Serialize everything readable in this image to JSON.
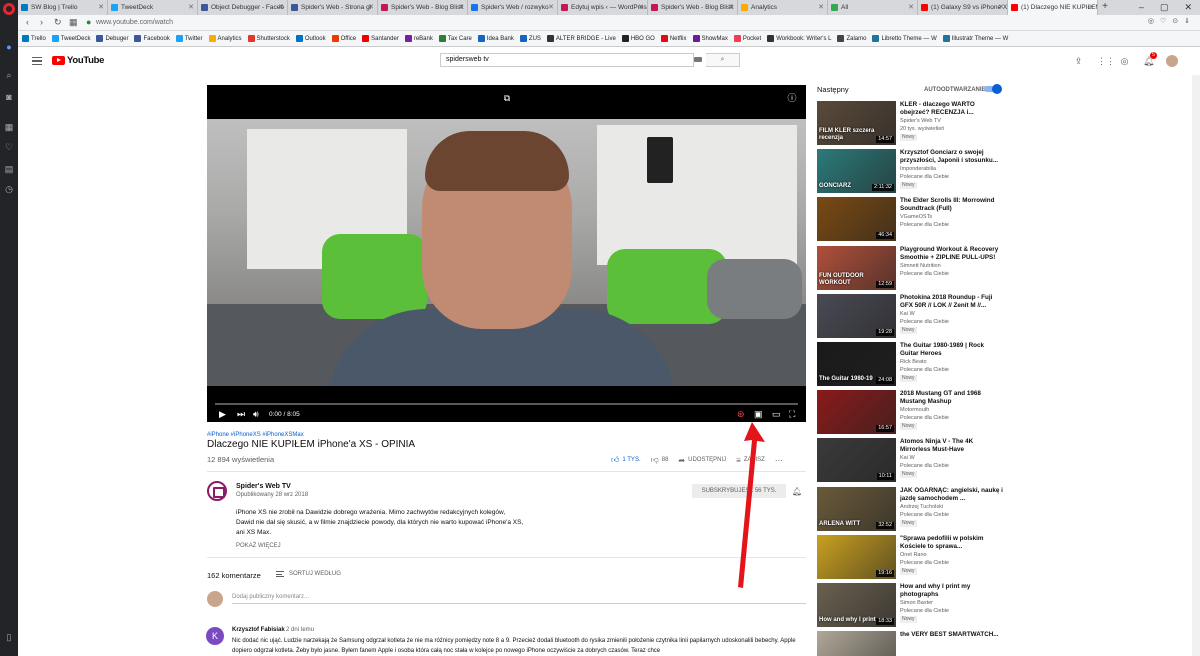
{
  "browser": {
    "tabs": [
      {
        "label": "SW Blog | Trello",
        "color": "#0079bf"
      },
      {
        "label": "TweetDeck",
        "color": "#1da1f2"
      },
      {
        "label": "Object Debugger - Faceb",
        "color": "#3b5998"
      },
      {
        "label": "Spider's Web - Strona gł",
        "color": "#3b5998"
      },
      {
        "label": "Spider's Web - Blog Blisk",
        "color": "#c2185b"
      },
      {
        "label": "Spider's Web / rozwyko",
        "color": "#1a73e8"
      },
      {
        "label": "Edytuj wpis ‹ — WordPres",
        "color": "#c2185b"
      },
      {
        "label": "Spider's Web - Blog Blisk",
        "color": "#c2185b"
      },
      {
        "label": "Analytics",
        "color": "#f9ab00"
      },
      {
        "label": "All",
        "color": "#34a853"
      },
      {
        "label": "(1) Galaxy S9 vs iPhone X",
        "color": "#ff0000"
      },
      {
        "label": "(1) Dlaczego NIE KUPIŁEM",
        "color": "#ff0000"
      }
    ],
    "url": "www.youtube.com/watch",
    "bookmarks": [
      {
        "label": "Trello",
        "color": "#0079bf"
      },
      {
        "label": "TweetDeck",
        "color": "#1da1f2"
      },
      {
        "label": "Debuger",
        "color": "#3b5998"
      },
      {
        "label": "Facebook",
        "color": "#3b5998"
      },
      {
        "label": "Twitter",
        "color": "#1da1f2"
      },
      {
        "label": "Analytics",
        "color": "#f9ab00"
      },
      {
        "label": "Shutterstock",
        "color": "#e2382c"
      },
      {
        "label": "Outlook",
        "color": "#0072c6"
      },
      {
        "label": "Office",
        "color": "#eb3c00"
      },
      {
        "label": "Santander",
        "color": "#ec0000"
      },
      {
        "label": "reBank",
        "color": "#7b1fa2"
      },
      {
        "label": "Tax Care",
        "color": "#2e7d32"
      },
      {
        "label": "Idea Bank",
        "color": "#1565c0"
      },
      {
        "label": "ZUS",
        "color": "#1565c0"
      },
      {
        "label": "ALTER BRIDGE - Live",
        "color": "#333333"
      },
      {
        "label": "HBO GO",
        "color": "#222222"
      },
      {
        "label": "Netflix",
        "color": "#e50914"
      },
      {
        "label": "ShowMax",
        "color": "#6a1b9a"
      },
      {
        "label": "Pocket",
        "color": "#ef3f56"
      },
      {
        "label": "Workbook: Writer's L",
        "color": "#333333"
      },
      {
        "label": "Zalamo",
        "color": "#444444"
      },
      {
        "label": "Libretto Theme — W",
        "color": "#21759b"
      },
      {
        "label": "Illustratr Theme — W",
        "color": "#21759b"
      }
    ]
  },
  "header": {
    "logo_text": "YouTube",
    "search_value": "spidersweb tv",
    "notifications_count": "5"
  },
  "player": {
    "time": "0:00 / 8:05",
    "progress_fraction": 0
  },
  "video": {
    "hashtags": "#iPhone #iPhoneXS #iPhoneXSMax",
    "title": "Dlaczego NIE KUPIŁEM iPhone'a XS - OPINIA",
    "views": "12 894 wyświetlenia",
    "likes": "1 TYS.",
    "dislikes": "88",
    "share_label": "UDOSTĘPNIJ",
    "save_label": "ZAPISZ"
  },
  "channel": {
    "name": "Spider's Web TV",
    "published": "Opublikowany 28 wrz 2018",
    "subscribe_label": "SUBSKRYBUJESZ 56 TYS.",
    "description": [
      "iPhone XS nie zrobił na Dawidzie dobrego wrażenia. Mimo zachwytów redakcyjnych kolegów,",
      "Dawid nie dał się skusić, a w filmie znajdziecie powody, dla których nie warto kupować iPhone'a XS,",
      "ani XS Max."
    ],
    "show_more": "POKAŻ WIĘCEJ"
  },
  "comments": {
    "count": "162 komentarze",
    "sort_label": "SORTUJ WEDŁUG",
    "input_placeholder": "Dodaj publiczny komentarz...",
    "first": {
      "avatar_letter": "K",
      "author": "Krzysztof Fabisiak",
      "time": "2 dni temu",
      "text": "Nic dodać nic ująć. Ludzie narzekają że Samsung odgrzał kotleta że nie ma różnicy pomiędzy note 8 a 9. Przecież dodali bluetooth do rysika zmienili położenie czytnika linii papilarnych udoskonalili bebechy.  Apple dopiero odgrzał kotleta. Żeby było jasne. Byłem fanem Apple i osoba która całą noc stała w kolejce po nowego iPhone oczywiście za dobrych czasów. Teraz chce"
    }
  },
  "sidebar": {
    "next_label": "Następny",
    "autoplay_label": "AUTOODTWARZANIE",
    "items": [
      {
        "title": "KLER - dlaczego WARTO obejrzeć? RECENZJA i...",
        "channel": "Spider's Web TV",
        "meta": "20 tys. wyświetleń",
        "badge": "Nowy",
        "duration": "14:57",
        "thumb_text": "FILM KLER szczera recenzja",
        "thumb_color": "#5a4a3a"
      },
      {
        "title": "Krzysztof Gonciarz o swojej przyszłości, Japonii i stosunku...",
        "channel": "Imponderabilia",
        "meta": "Polecane dla Ciebie",
        "badge": "Nowy",
        "duration": "2:11:32",
        "thumb_text": "GONCIARZ",
        "thumb_color": "#2c7a7a"
      },
      {
        "title": "The Elder Scrolls III: Morrowind Soundtrack (Full)",
        "channel": "VGameOSTs",
        "meta": "Polecane dla Ciebie",
        "badge": "",
        "duration": "46:34",
        "thumb_text": "",
        "thumb_color": "#7a4a12"
      },
      {
        "title": "Playground Workout & Recovery Smoothie + ZIPLINE PULL-UPS!",
        "channel": "Simnett Nutrition",
        "meta": "Polecane dla Ciebie",
        "badge": "",
        "duration": "12:59",
        "thumb_text": "FUN OUTDOOR WORKOUT",
        "thumb_color": "#b0503a"
      },
      {
        "title": "Photokina 2018 Roundup - Fuji GFX 50R // LOK // Zenit M //...",
        "channel": "Kai W",
        "meta": "Polecane dla Ciebie",
        "badge": "Nowy",
        "duration": "19:28",
        "thumb_text": "",
        "thumb_color": "#4a4a55"
      },
      {
        "title": "The Guitar 1980-1989 | Rock Guitar Heroes",
        "channel": "Rick Beato",
        "meta": "Polecane dla Ciebie",
        "badge": "Nowy",
        "duration": "24:08",
        "thumb_text": "The Guitar 1980-19",
        "thumb_color": "#1a1a1a"
      },
      {
        "title": "2018 Mustang GT and 1968 Mustang Mashup",
        "channel": "Motormouth",
        "meta": "Polecane dla Ciebie",
        "badge": "Nowy",
        "duration": "16:57",
        "thumb_text": "",
        "thumb_color": "#8a1a1a"
      },
      {
        "title": "Atomos Ninja V - The 4K Mirrorless Must-Have",
        "channel": "Kai W",
        "meta": "Polecane dla Ciebie",
        "badge": "Nowy",
        "duration": "10:11",
        "thumb_text": "",
        "thumb_color": "#3a3a3a"
      },
      {
        "title": "JAK OGARNĄĆ: angielski, naukę i jazdę samochodem ...",
        "channel": "Andrzej Tucholski",
        "meta": "Polecane dla Ciebie",
        "badge": "Nowy",
        "duration": "32:52",
        "thumb_text": "ARLENA WITT",
        "thumb_color": "#6a5a3a"
      },
      {
        "title": "\"Sprawa pedofilii w polskim Kościele to sprawa...",
        "channel": "Onet Rano",
        "meta": "Polecane dla Ciebie",
        "badge": "Nowy",
        "duration": "19:16",
        "thumb_text": "",
        "thumb_color": "#c9a020"
      },
      {
        "title": "How and why I print my photographs",
        "channel": "Simon Baxter",
        "meta": "Polecane dla Ciebie",
        "badge": "Nowy",
        "duration": "18:33",
        "thumb_text": "How and why I print",
        "thumb_color": "#6a6050"
      },
      {
        "title": "the VERY BEST SMARTWATCH...",
        "channel": "",
        "meta": "",
        "badge": "",
        "duration": "",
        "thumb_text": "",
        "thumb_color": "#b0a898"
      }
    ]
  }
}
